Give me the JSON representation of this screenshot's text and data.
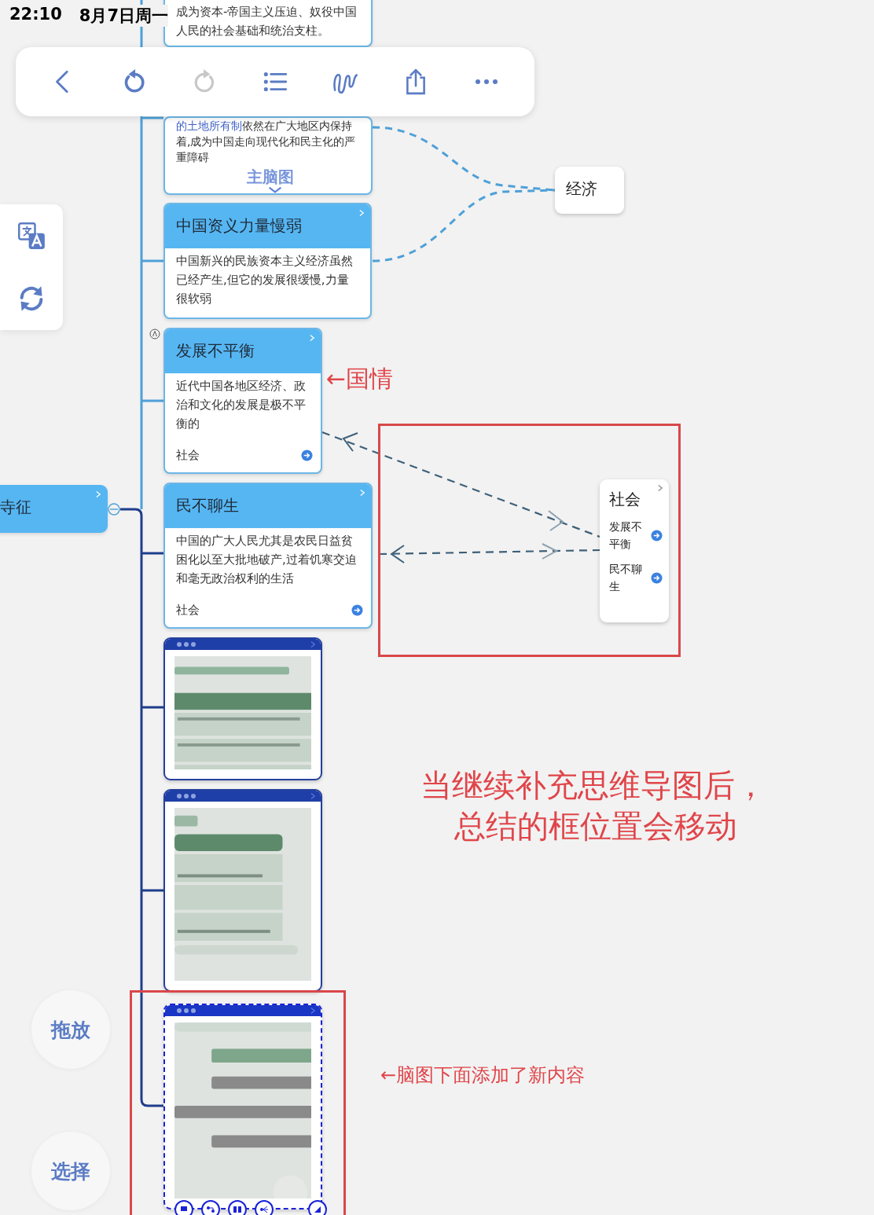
{
  "status_bar": {
    "time": "22:10",
    "date": "8月7日周一"
  },
  "toolbar": {
    "buttons": [
      {
        "kind": "back",
        "disabled": false
      },
      {
        "kind": "undo",
        "disabled": false
      },
      {
        "kind": "redo",
        "disabled": true
      },
      {
        "kind": "outline",
        "disabled": false
      },
      {
        "kind": "draw",
        "disabled": false
      },
      {
        "kind": "share",
        "disabled": false
      },
      {
        "kind": "more",
        "disabled": false
      }
    ]
  },
  "side_panel": {
    "buttons": [
      {
        "kind": "translate"
      },
      {
        "kind": "sync"
      }
    ]
  },
  "mode_buttons": [
    {
      "label": "拖放"
    },
    {
      "label": "选择"
    }
  ],
  "mind_map": {
    "root": {
      "title": "寺征"
    },
    "topics": [
      {
        "kind": "partial",
        "body": [
          {
            "text": "成为资本-帝国主义压迫、奴役中国人民的社会基础和统治支柱。",
            "link": false
          }
        ]
      },
      {
        "kind": "partial",
        "body": [
          {
            "text": "的土地所有制",
            "link": true
          },
          {
            "text": "依然在广大地区内保持着,成为中国走向现代化和民主化的严重障碍",
            "link": false
          }
        ],
        "overlay_label": "主脑图"
      },
      {
        "kind": "topic",
        "title": "中国资义力量慢弱",
        "body": [
          {
            "text": "中国新兴的民族资本主义经济虽然已经产生,但它的发展很缓慢,力量很软弱",
            "link": false
          }
        ]
      },
      {
        "kind": "topic",
        "title": "发展不平衡",
        "body": [
          {
            "text": "近代中国各地区经济、政治和文化的发展是极不平衡的",
            "link": false
          }
        ],
        "tag": "社会"
      },
      {
        "kind": "topic",
        "title": "民不聊生",
        "body": [
          {
            "text": "中国的广大人民尤其是农民日益贫困化以至大批地破产,过着饥寒交迫和毫无政治权利的生活",
            "link": false
          }
        ],
        "tag": "社会"
      }
    ],
    "image_nodes": [
      {
        "kind": "picture",
        "selected": false
      },
      {
        "kind": "picture",
        "selected": false
      },
      {
        "kind": "picture",
        "selected": true
      }
    ],
    "summaries": [
      {
        "title": "经济"
      },
      {
        "title": "社会",
        "items": [
          "发展不平衡",
          "民不聊生"
        ]
      }
    ]
  },
  "annotations": [
    {
      "kind": "arrow_note",
      "text": "←国情"
    },
    {
      "kind": "frame"
    },
    {
      "kind": "note",
      "lines": [
        "当继续补充思维导图后，",
        "总结的框位置会移动"
      ]
    },
    {
      "kind": "frame"
    },
    {
      "kind": "arrow_note",
      "text": "←脑图下面添加了新内容"
    }
  ]
}
